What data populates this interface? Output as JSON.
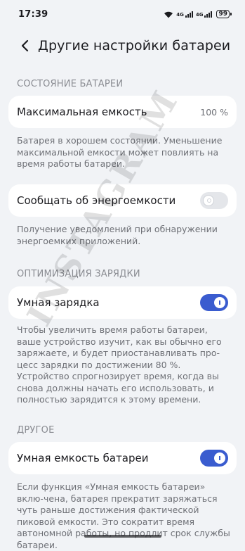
{
  "status_bar": {
    "time": "17:39",
    "net1": "4G",
    "net2": "4G",
    "battery": "99"
  },
  "header": {
    "title": "Другие настройки батареи"
  },
  "sections": {
    "battery_state": {
      "title": "СОСТОЯНИЕ БАТАРЕИ",
      "max_capacity_label": "Максимальная емкость",
      "max_capacity_value": "100 %",
      "max_capacity_desc": "Батарея в хорошем состоянии. Уменьшение максимальной емкости может повлиять на время работы батареи.",
      "energy_label": "Сообщать об энергоемкости",
      "energy_toggle": false,
      "energy_desc": "Получение уведомлений при обнаружении энергоемких приложений."
    },
    "charging": {
      "title": "ОПТИМИЗАЦИЯ ЗАРЯДКИ",
      "smart_charging_label": "Умная зарядка",
      "smart_charging_toggle": true,
      "smart_charging_desc": "Чтобы увеличить время работы батареи, ваше устройство изучит, как вы обычно его заряжаете, и будет приостанавливать про-цесс зарядки по достижении 80 %. Устройство спрогнозирует время, когда вы снова должны начать его использовать, и полностью зарядится к этому времени."
    },
    "other": {
      "title": "ДРУГОЕ",
      "smart_capacity_label": "Умная емкость батареи",
      "smart_capacity_toggle": true,
      "smart_capacity_desc": "Если функция «Умная емкость батареи» вклю-чена, батарея прекратит заряжаться чуть раньше достижения фактической пиковой емкости. Это сократит время автономной работы, но продлит срок службы батареи."
    }
  },
  "watermark": "INSTAGRAM",
  "colors": {
    "background": "#f1f3f6",
    "card": "#ffffff",
    "accent": "#3a5ccf",
    "secondary_text": "#6e7076"
  }
}
